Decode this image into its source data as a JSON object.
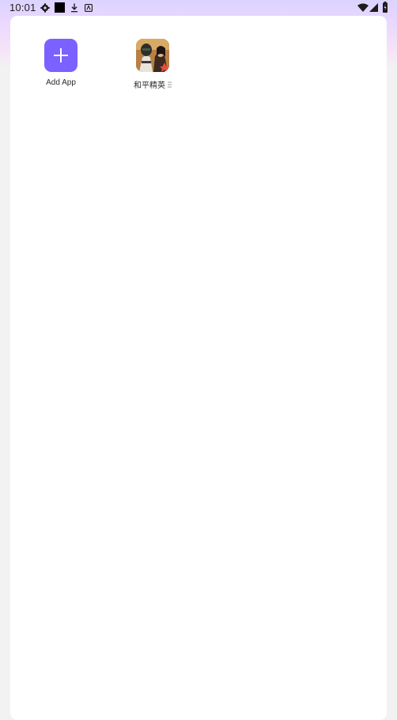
{
  "status_bar": {
    "time": "10:01",
    "left_icons": [
      "settings-gear-icon",
      "black-square-icon",
      "download-icon",
      "app-notification-icon"
    ],
    "right_icons": [
      "wifi-icon",
      "signal-icon",
      "battery-icon"
    ]
  },
  "apps": [
    {
      "label": "Add App",
      "icon": "plus-icon"
    },
    {
      "label": "和平精英",
      "icon": "game-icon",
      "has_menu": true
    }
  ],
  "colors": {
    "accent": "#7b61ff",
    "card_background": "#ffffff",
    "page_background": "#f2f2f3"
  }
}
